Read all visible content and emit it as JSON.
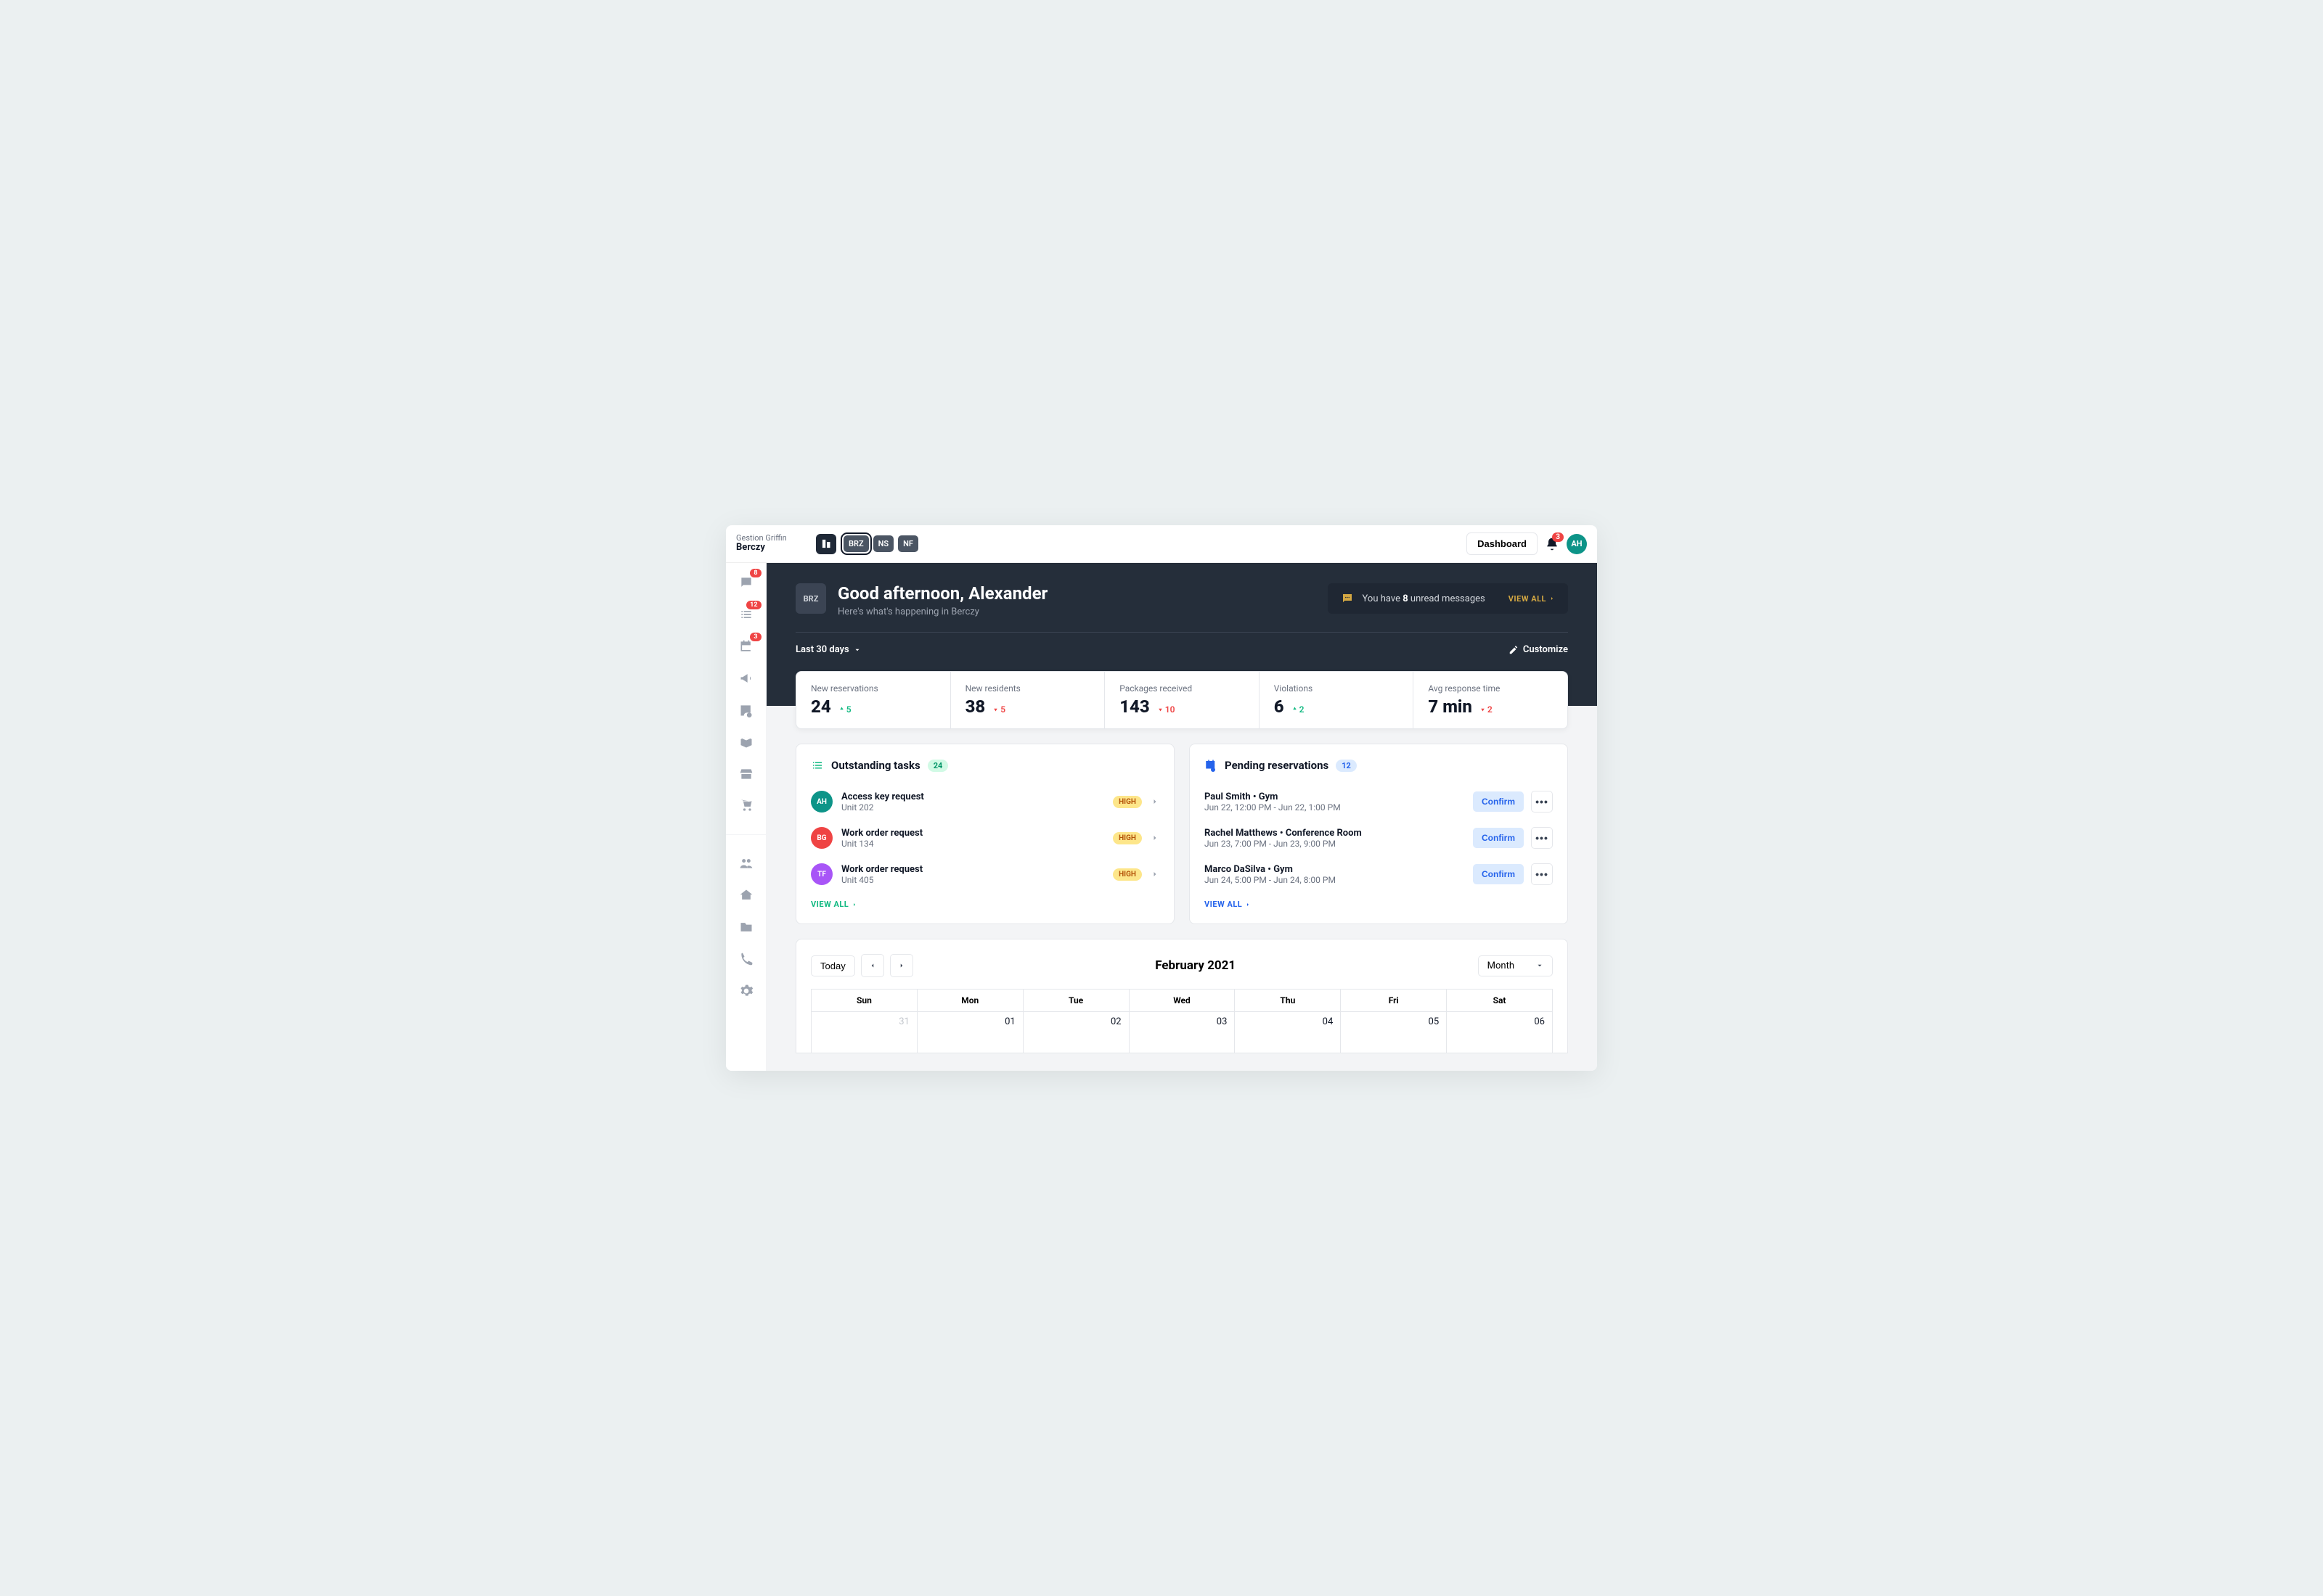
{
  "topbar": {
    "org": "Gestion Griffin",
    "building": "Berczy",
    "chips": [
      "BRZ",
      "NS",
      "NF"
    ],
    "dashboard_label": "Dashboard",
    "bell_count": "3",
    "avatar_initials": "AH"
  },
  "sidebar": {
    "badges": {
      "chat": "8",
      "tasks": "12",
      "calendar": "3"
    }
  },
  "hero": {
    "badge": "BRZ",
    "title": "Good afternoon, Alexander",
    "subtitle": "Here's what's happening in Berczy",
    "msg_prefix": "You have ",
    "msg_count": "8",
    "msg_suffix": " unread messages",
    "view_all": "VIEW ALL",
    "range_label": "Last 30 days",
    "customize": "Customize"
  },
  "stats": [
    {
      "label": "New reservations",
      "value": "24",
      "delta": "5",
      "dir": "up"
    },
    {
      "label": "New residents",
      "value": "38",
      "delta": "5",
      "dir": "down"
    },
    {
      "label": "Packages received",
      "value": "143",
      "delta": "10",
      "dir": "down"
    },
    {
      "label": "Violations",
      "value": "6",
      "delta": "2",
      "dir": "up"
    },
    {
      "label": "Avg response time",
      "value": "7 min",
      "delta": "2",
      "dir": "down"
    }
  ],
  "tasks": {
    "title": "Outstanding tasks",
    "count": "24",
    "view_all": "VIEW ALL",
    "items": [
      {
        "initials": "AH",
        "color": "#0D9488",
        "title": "Access key request",
        "sub": "Unit 202",
        "priority": "HIGH"
      },
      {
        "initials": "BG",
        "color": "#EF4444",
        "title": "Work order request",
        "sub": "Unit 134",
        "priority": "HIGH"
      },
      {
        "initials": "TF",
        "color": "#A855F7",
        "title": "Work order request",
        "sub": "Unit 405",
        "priority": "HIGH"
      }
    ]
  },
  "reservations": {
    "title": "Pending reservations",
    "count": "12",
    "view_all": "VIEW ALL",
    "confirm_label": "Confirm",
    "items": [
      {
        "title": "Paul Smith • Gym",
        "sub": "Jun 22, 12:00 PM - Jun 22, 1:00 PM"
      },
      {
        "title": "Rachel Matthews • Conference Room",
        "sub": "Jun 23, 7:00 PM - Jun 23, 9:00 PM"
      },
      {
        "title": "Marco DaSilva • Gym",
        "sub": "Jun 24, 5:00 PM - Jun 24, 8:00 PM"
      }
    ]
  },
  "calendar": {
    "today": "Today",
    "title": "February 2021",
    "view": "Month",
    "days": [
      "Sun",
      "Mon",
      "Tue",
      "Wed",
      "Thu",
      "Fri",
      "Sat"
    ],
    "row1": [
      "31",
      "01",
      "02",
      "03",
      "04",
      "05",
      "06"
    ]
  }
}
